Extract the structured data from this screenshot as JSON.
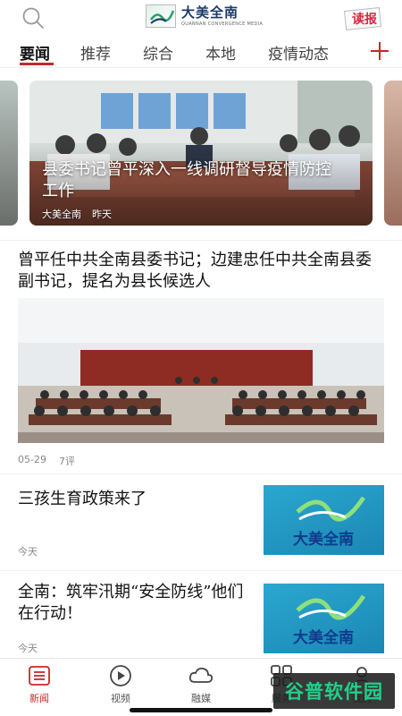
{
  "header": {
    "logo_title": "大美全南",
    "logo_sub": "QUANNAN CONVERGENCE MEDIA",
    "read_paper_label": "读报"
  },
  "tabs": [
    {
      "label": "要闻",
      "active": true
    },
    {
      "label": "推荐",
      "active": false
    },
    {
      "label": "综合",
      "active": false
    },
    {
      "label": "本地",
      "active": false
    },
    {
      "label": "疫情动态",
      "active": false
    }
  ],
  "carousel": {
    "caption": "县委书记曾平深入一线调研督导疫情防控工作",
    "source": "大美全南",
    "time": "昨天"
  },
  "feature_article": {
    "title": "曾平任中共全南县委书记；边建忠任中共全南县委副书记，提名为县长候选人",
    "date": "05-29",
    "comments": "7评"
  },
  "list_items": [
    {
      "title": "三孩生育政策来了",
      "time": "今天",
      "thumb_text": "大美全南"
    },
    {
      "title": "全南：筑牢汛期“安全防线”他们在行动！",
      "time": "今天",
      "thumb_text": "大美全南"
    }
  ],
  "bottom_nav": [
    {
      "label": "新闻",
      "icon": "news-icon",
      "active": true
    },
    {
      "label": "视频",
      "icon": "video-icon",
      "active": false
    },
    {
      "label": "融媒",
      "icon": "cloud-icon",
      "active": false
    },
    {
      "label": "服务",
      "icon": "grid-icon",
      "active": false
    },
    {
      "label": "我的",
      "icon": "user-icon",
      "active": false
    }
  ],
  "watermark": "谷普软件园",
  "colors": {
    "accent": "#c62828",
    "thumb_blue": "#1b86b5"
  }
}
